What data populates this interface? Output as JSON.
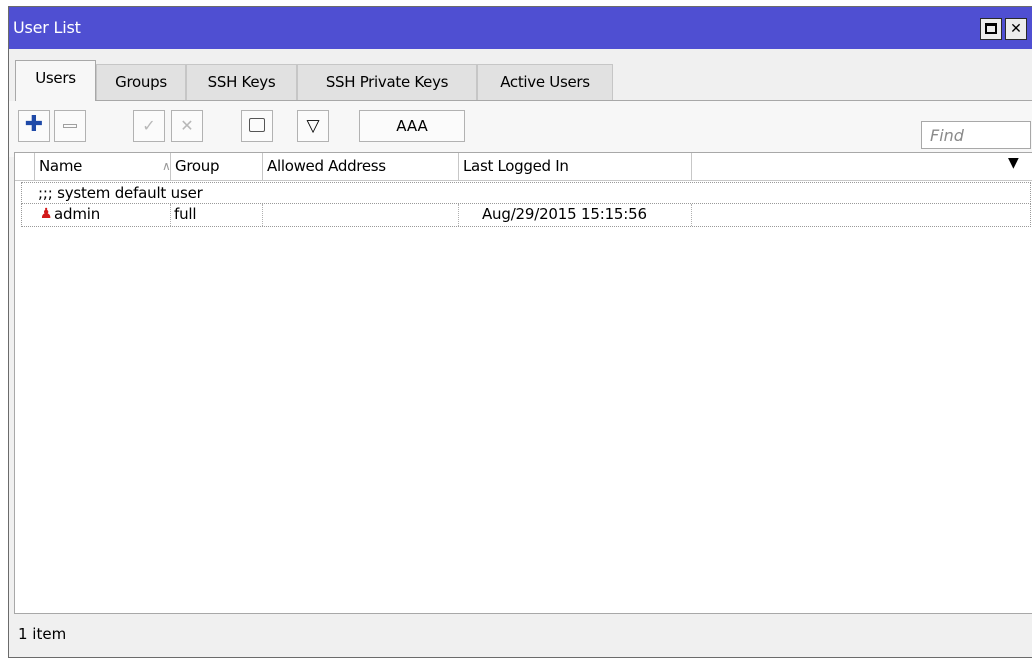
{
  "window": {
    "title": "User List",
    "accent_color": "#4f4fd2"
  },
  "tabs": [
    {
      "label": "Users",
      "active": true
    },
    {
      "label": "Groups",
      "active": false
    },
    {
      "label": "SSH Keys",
      "active": false
    },
    {
      "label": "SSH Private Keys",
      "active": false
    },
    {
      "label": "Active Users",
      "active": false
    }
  ],
  "toolbar": {
    "icons": [
      "plus-icon",
      "minus-icon",
      "check-icon",
      "x-icon",
      "comment-icon",
      "filter-icon"
    ],
    "aaa_label": "AAA",
    "find_placeholder": "Find"
  },
  "table": {
    "columns": [
      "Name",
      "Group",
      "Allowed Address",
      "Last Logged In"
    ],
    "rows": [
      {
        "comment": ";;; system default user",
        "name": "admin",
        "group": "full",
        "allowed_address": "",
        "last_logged_in": "Aug/29/2015 15:15:56"
      }
    ]
  },
  "status": {
    "count_text": "1 item"
  }
}
